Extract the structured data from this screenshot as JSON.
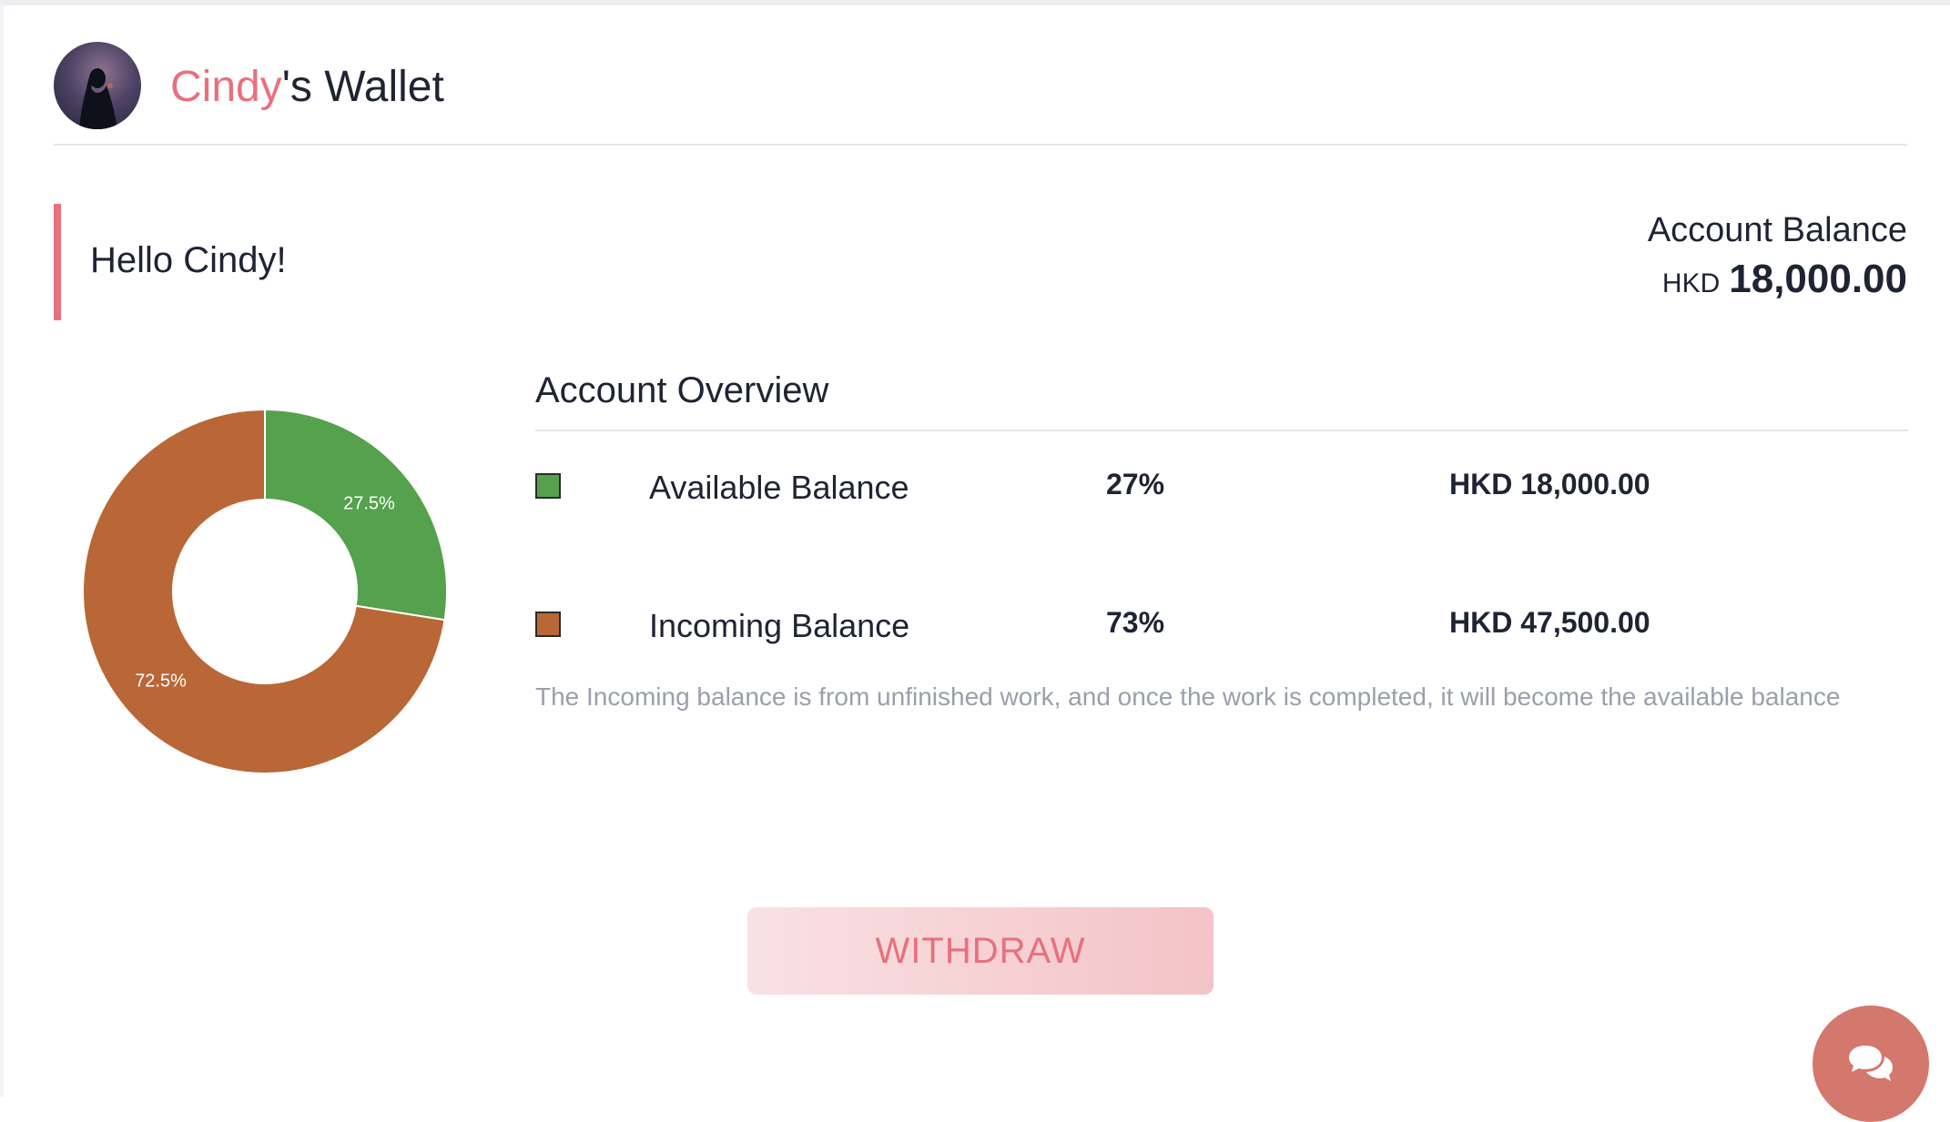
{
  "header": {
    "avatar_icon": "user-avatar-silhouette",
    "title_name": "Cindy",
    "title_suffix": "'s Wallet"
  },
  "greeting": "Hello Cindy!",
  "account_balance": {
    "label": "Account Balance",
    "currency": "HKD",
    "amount": "18,000.00"
  },
  "overview": {
    "title": "Account Overview",
    "rows": [
      {
        "label": "Available Balance",
        "percent": "27%",
        "amount": "HKD 18,000.00",
        "color": "#55a14d"
      },
      {
        "label": "Incoming Balance",
        "percent": "73%",
        "amount": "HKD 47,500.00",
        "color": "#b96737"
      }
    ],
    "note": "The Incoming balance is from unfinished work, and once the work is completed, it will become the available balance"
  },
  "chart_data": {
    "type": "pie",
    "variant": "donut",
    "categories": [
      "Available Balance",
      "Incoming Balance"
    ],
    "values": [
      27.5,
      72.5
    ],
    "labels": [
      "27.5%",
      "72.5%"
    ],
    "colors": [
      "#55a14d",
      "#b96737"
    ]
  },
  "actions": {
    "withdraw_label": "WITHDRAW",
    "chat_icon": "chat-bubbles-icon"
  },
  "colors": {
    "accent": "#e8707d",
    "chat_button": "#d4776c",
    "text": "#1f2433",
    "muted": "#9aa0ab"
  }
}
